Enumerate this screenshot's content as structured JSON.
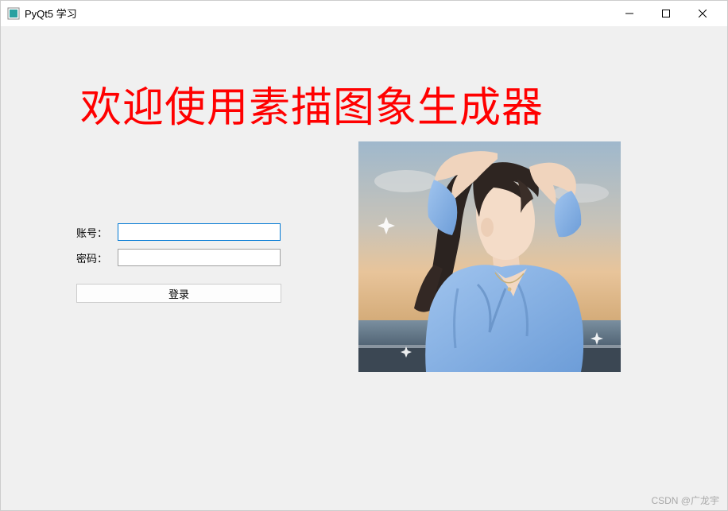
{
  "window": {
    "title": "PyQt5 学习"
  },
  "heading": "欢迎使用素描图象生成器",
  "form": {
    "username_label": "账号：",
    "username_value": "",
    "password_label": "密码：",
    "password_value": "",
    "login_button": "登录"
  },
  "image": {
    "alt": "portrait-photo"
  },
  "watermark": "CSDN @广龙宇"
}
